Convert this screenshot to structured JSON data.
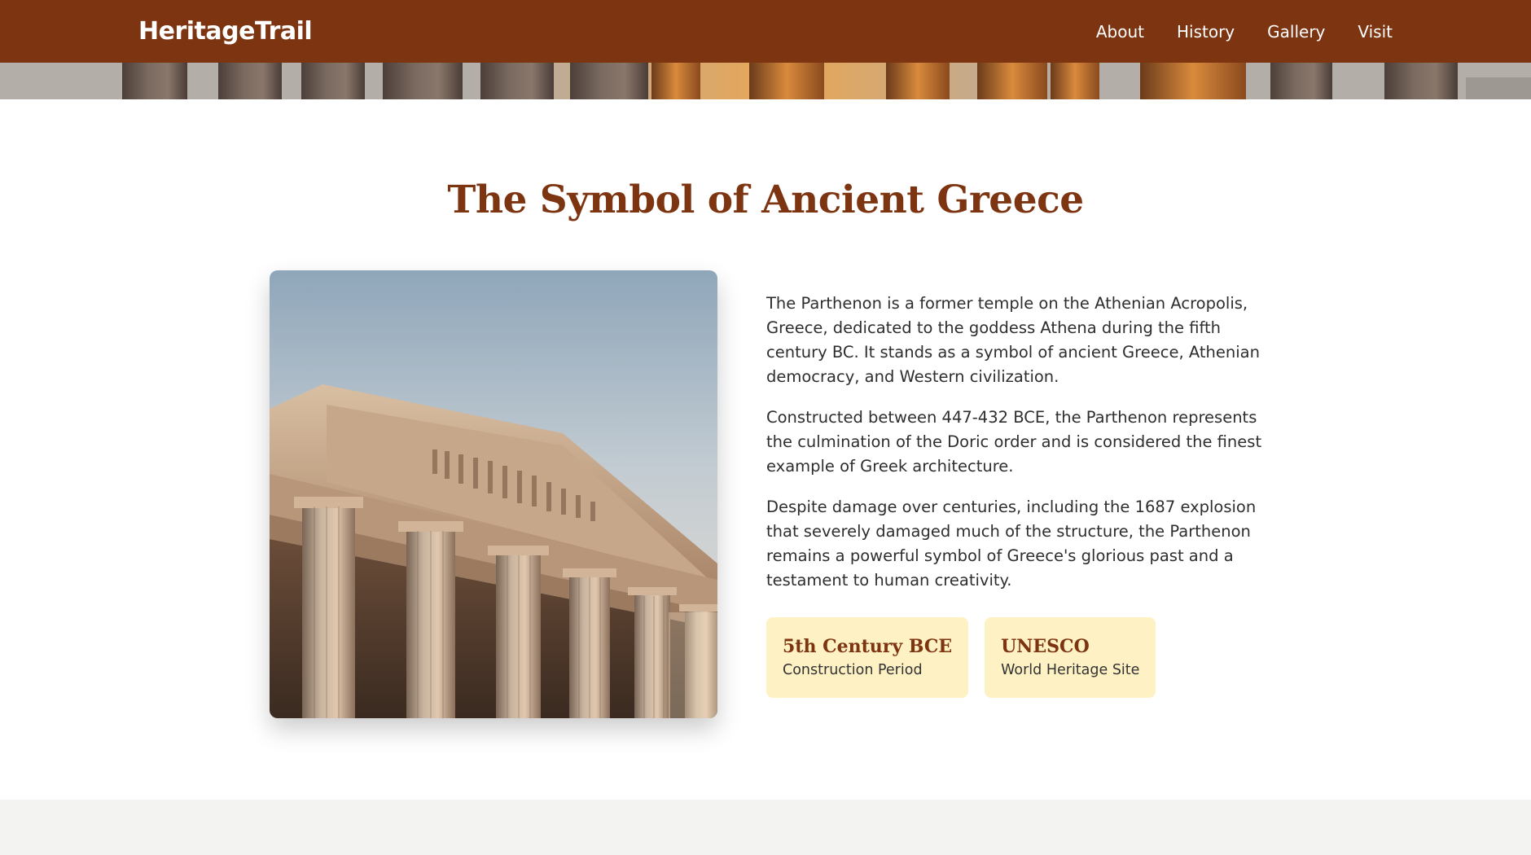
{
  "header": {
    "logo": "HeritageTrail",
    "nav": [
      "About",
      "History",
      "Gallery",
      "Visit"
    ]
  },
  "section": {
    "title": "The Symbol of Ancient Greece",
    "paragraphs": [
      "The Parthenon is a former temple on the Athenian Acropolis, Greece, dedicated to the goddess Athena during the fifth century BC. It stands as a symbol of ancient Greece, Athenian democracy, and Western civilization.",
      "Constructed between 447-432 BCE, the Parthenon represents the culmination of the Doric order and is considered the finest example of Greek architecture.",
      "Despite damage over centuries, including the 1687 explosion that severely damaged much of the structure, the Parthenon remains a powerful symbol of Greece's glorious past and a testament to human creativity."
    ],
    "badges": [
      {
        "title": "5th Century BCE",
        "subtitle": "Construction Period"
      },
      {
        "title": "UNESCO",
        "subtitle": "World Heritage Site"
      }
    ]
  },
  "colors": {
    "brand": "#7d3411",
    "badge_bg": "#fef1c4",
    "footer_bg": "#f3f3f1"
  }
}
